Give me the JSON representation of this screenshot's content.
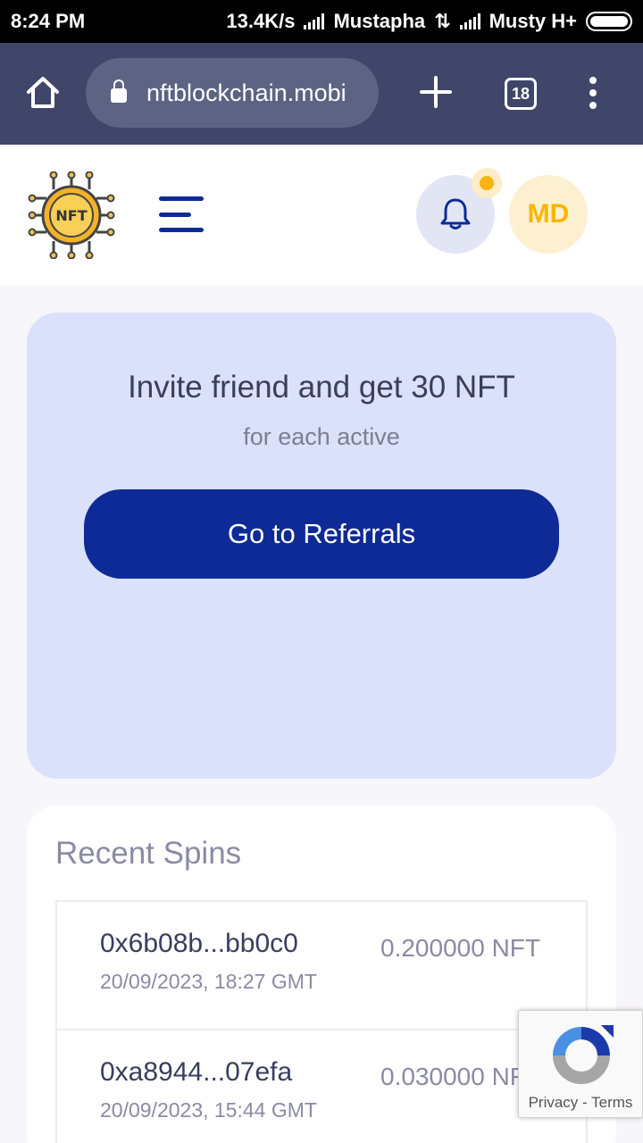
{
  "status_bar": {
    "time": "8:24 PM",
    "speed": "13.4K/s",
    "carrier1": "Mustapha",
    "data_arrows": "⇅",
    "carrier2": "Musty H+"
  },
  "browser": {
    "url": "nftblockchain.mobi",
    "tab_count": "18"
  },
  "header": {
    "logo_text": "NFT",
    "avatar_initials": "MD"
  },
  "invite": {
    "title": "Invite friend and get 30 NFT",
    "subtitle": "for each active",
    "button_label": "Go to Referrals"
  },
  "recent_spins": {
    "title": "Recent Spins",
    "items": [
      {
        "hash": "0x6b08b...bb0c0",
        "date": "20/09/2023, 18:27 GMT",
        "amount": "0.200000 NFT"
      },
      {
        "hash": "0xa8944...07efa",
        "date": "20/09/2023, 15:44 GMT",
        "amount": "0.030000 NFT"
      }
    ]
  },
  "recaptcha": {
    "privacy": "Privacy",
    "separator": "-",
    "terms": "Terms"
  },
  "colors": {
    "primary": "#0d2a96",
    "accent": "#f7b500",
    "browser_bar": "#3f4669",
    "card_bg": "#dbe1fb"
  }
}
